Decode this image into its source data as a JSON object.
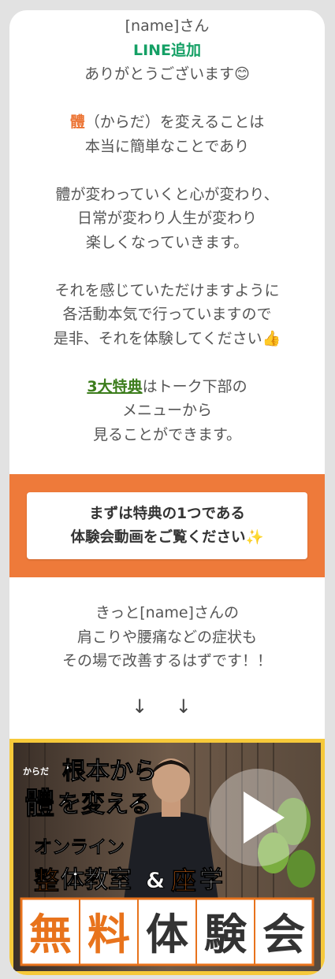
{
  "greeting": {
    "name_line": "[name]さん",
    "line_add": "LINE追加",
    "thanks": "ありがとうございます😊"
  },
  "body_message": {
    "highlight_word": "體",
    "line1_rest": "（からだ）を変えることは",
    "line2": "本当に簡単なことであり",
    "line3": "體が変わっていくと心が変わり、",
    "line4": "日常が変わり人生が変わり",
    "line5": "楽しくなっていきます。",
    "line6": "それを感じていただけますように",
    "line7": "各活動本気で行っていますので",
    "line8": "是非、それを体験してください👍"
  },
  "perks": {
    "highlight": "3大特典",
    "line1_rest": "はトーク下部の",
    "line2": "メニューから",
    "line3": "見ることができます。"
  },
  "banner": {
    "line1": "まずは特典の1つである",
    "line2": "体験会動画をご覧ください✨"
  },
  "closing": {
    "line1": "きっと[name]さんの",
    "line2": "肩こりや腰痛などの症状も",
    "line3": "その場で改善するはずです！！",
    "arrows": "↓ ↓"
  },
  "video": {
    "ruby": "からだ",
    "headline1": "根本から",
    "headline2_kanji": "體",
    "headline2_rest": "を変える",
    "online": "オンライン",
    "course_a": "整",
    "course_b": "体教室",
    "amp": "&",
    "course_c": "座",
    "course_d": "学",
    "free_chars": [
      "無",
      "料",
      "体",
      "験",
      "会"
    ],
    "play_icon": "play-icon",
    "colors": {
      "frame": "#f6c93a",
      "accent": "#e8731c",
      "banner_bg": "#ee7a3a",
      "line_green": "#14a065",
      "perk_green": "#3c7d1c"
    }
  }
}
